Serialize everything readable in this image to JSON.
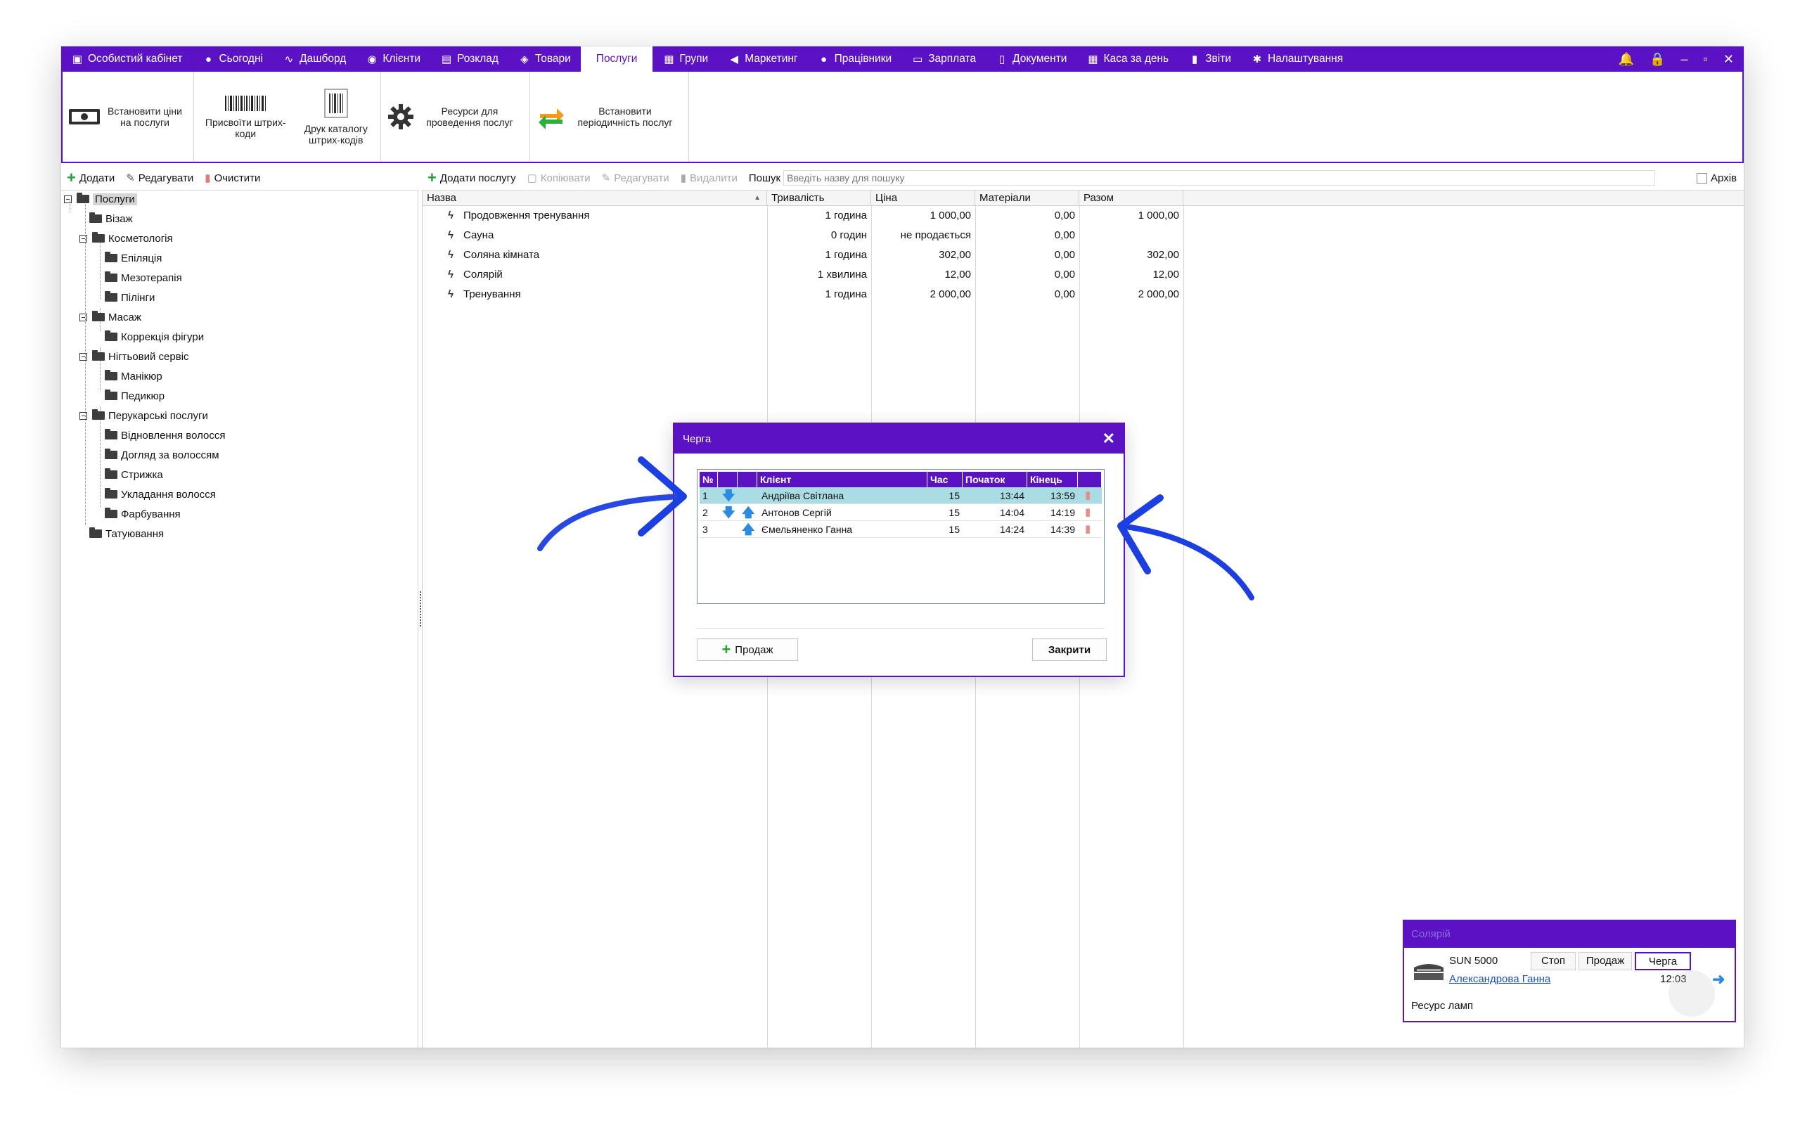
{
  "menu": {
    "items": [
      {
        "label": "Особистий кабінет",
        "icon": "cabinet-icon",
        "glyph": "▣"
      },
      {
        "label": "Сьогодні",
        "icon": "today-icon",
        "glyph": "●"
      },
      {
        "label": "Дашборд",
        "icon": "pulse-icon",
        "glyph": "∿"
      },
      {
        "label": "Клієнти",
        "icon": "client-icon",
        "glyph": "◉"
      },
      {
        "label": "Розклад",
        "icon": "calendar-icon",
        "glyph": "▤"
      },
      {
        "label": "Товари",
        "icon": "box-icon",
        "glyph": "◈"
      },
      {
        "label": "Послуги",
        "icon": "",
        "glyph": ""
      },
      {
        "label": "Групи",
        "icon": "groups-icon",
        "glyph": "▦"
      },
      {
        "label": "Маркетинг",
        "icon": "megaphone-icon",
        "glyph": "◀"
      },
      {
        "label": "Працівники",
        "icon": "person-icon",
        "glyph": "●"
      },
      {
        "label": "Зарплата",
        "icon": "money-icon",
        "glyph": "▭"
      },
      {
        "label": "Документи",
        "icon": "document-icon",
        "glyph": "▯"
      },
      {
        "label": "Каса за день",
        "icon": "calculator-icon",
        "glyph": "▦"
      },
      {
        "label": "Звіти",
        "icon": "bars-icon",
        "glyph": "▮"
      },
      {
        "label": "Налаштування",
        "icon": "gear-icon",
        "glyph": "✱"
      }
    ],
    "active_index": 6,
    "window_controls": {
      "bell": "🔔",
      "lock": "🔒",
      "minimize": "–",
      "restore": "▫",
      "close": "✕"
    }
  },
  "ribbon": {
    "set_prices": "Встановити ціни на послуги",
    "assign_barcodes": "Присвоїти штрих-коди",
    "print_catalog": "Друк каталогу штрих-кодів",
    "resources": "Ресурси для проведення послуг",
    "periodicity": "Встановити періодичність послуг"
  },
  "left_toolbar": {
    "add": "Додати",
    "edit": "Редагувати",
    "clear": "Очистити"
  },
  "tree": {
    "root": "Послуги",
    "nodes": [
      {
        "label": "Візаж"
      },
      {
        "label": "Косметологія"
      },
      {
        "label": "Епіляція"
      },
      {
        "label": "Мезотерапія"
      },
      {
        "label": "Пілінги"
      },
      {
        "label": "Масаж"
      },
      {
        "label": "Коррекція фігури"
      },
      {
        "label": "Нігтьовий сервіс"
      },
      {
        "label": "Манікюр"
      },
      {
        "label": "Педикюр"
      },
      {
        "label": "Перукарські послуги"
      },
      {
        "label": "Відновлення волосся"
      },
      {
        "label": "Догляд за волоссям"
      },
      {
        "label": "Стрижка"
      },
      {
        "label": "Укладання волосся"
      },
      {
        "label": "Фарбування"
      },
      {
        "label": "Татуювання"
      }
    ]
  },
  "grid_toolbar": {
    "add": "Додати послугу",
    "copy": "Копіювати",
    "edit": "Редагувати",
    "delete": "Видалити",
    "search_label": "Пошук",
    "search_placeholder": "Введіть назву для пошуку",
    "archive": "Архів"
  },
  "grid": {
    "headers": [
      "Назва",
      "Тривалість",
      "Ціна",
      "Матеріали",
      "Разом"
    ],
    "rows": [
      [
        "Продовження тренування",
        "1 година",
        "1 000,00",
        "0,00",
        "1 000,00"
      ],
      [
        "Сауна",
        "0 годин",
        "не продається",
        "0,00",
        ""
      ],
      [
        "Соляна кімната",
        "1 година",
        "302,00",
        "0,00",
        "302,00"
      ],
      [
        "Солярій",
        "1 хвилина",
        "12,00",
        "0,00",
        "12,00"
      ],
      [
        "Тренування",
        "1 година",
        "2 000,00",
        "0,00",
        "2 000,00"
      ]
    ]
  },
  "dialog": {
    "title": "Черга",
    "close": "✕",
    "headers": [
      "№",
      "",
      "",
      "Клієнт",
      "Час",
      "Початок",
      "Кінець",
      ""
    ],
    "rows": [
      {
        "n": "1",
        "client": "Андріїва Світлана",
        "time": "15",
        "start": "13:44",
        "end": "13:59"
      },
      {
        "n": "2",
        "client": "Антонов Сергій",
        "time": "15",
        "start": "14:04",
        "end": "14:19"
      },
      {
        "n": "3",
        "client": "Ємельяненко Ганна",
        "time": "15",
        "start": "14:24",
        "end": "14:39"
      }
    ],
    "sale_button": "Продаж",
    "close_button": "Закрити"
  },
  "solarium": {
    "title": "Солярій",
    "device": "SUN 5000",
    "stop": "Стоп",
    "sale": "Продаж",
    "queue": "Черга",
    "client": "Александрова Ганна",
    "time": "12:03",
    "resource": "Ресурс ламп"
  },
  "colors": {
    "accent": "#5a12c4",
    "selection": "#aadce3",
    "arrow": "#1b3fe0"
  }
}
